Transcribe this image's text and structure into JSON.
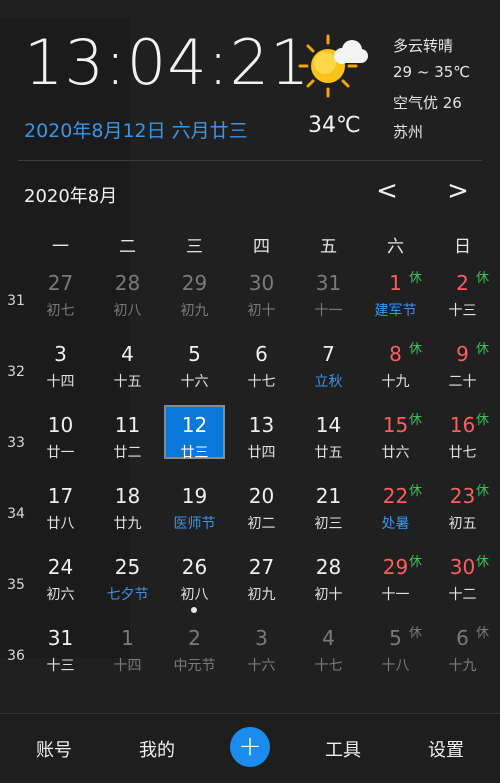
{
  "clock": {
    "time": "13:04:21"
  },
  "date": {
    "line": "2020年8月12日 六月廿三"
  },
  "weather": {
    "icon": "sun-cloud-icon",
    "current_temp": "34℃",
    "condition": "多云转晴",
    "temp_range": "29 ~ 35℃",
    "air_quality": "空气优 26",
    "city": "苏州"
  },
  "calendar": {
    "month_title": "2020年8月",
    "prev_label": "<",
    "next_label": ">",
    "weekdays": [
      "一",
      "二",
      "三",
      "四",
      "五",
      "六",
      "日"
    ],
    "weeks": [
      {
        "num": "31",
        "days": [
          {
            "d": "27",
            "l": "初七",
            "other": true
          },
          {
            "d": "28",
            "l": "初八",
            "other": true
          },
          {
            "d": "29",
            "l": "初九",
            "other": true
          },
          {
            "d": "30",
            "l": "初十",
            "other": true
          },
          {
            "d": "31",
            "l": "十一",
            "other": true
          },
          {
            "d": "1",
            "l": "建军节",
            "fest": true,
            "weekend": true,
            "hol": "休"
          },
          {
            "d": "2",
            "l": "十三",
            "weekend": true,
            "hol": "休"
          }
        ]
      },
      {
        "num": "32",
        "days": [
          {
            "d": "3",
            "l": "十四"
          },
          {
            "d": "4",
            "l": "十五"
          },
          {
            "d": "5",
            "l": "十六"
          },
          {
            "d": "6",
            "l": "十七"
          },
          {
            "d": "7",
            "l": "立秋",
            "fest": true
          },
          {
            "d": "8",
            "l": "十九",
            "weekend": true,
            "hol": "休"
          },
          {
            "d": "9",
            "l": "二十",
            "weekend": true,
            "hol": "休"
          }
        ]
      },
      {
        "num": "33",
        "days": [
          {
            "d": "10",
            "l": "廿一"
          },
          {
            "d": "11",
            "l": "廿二"
          },
          {
            "d": "12",
            "l": "廿三",
            "selected": true
          },
          {
            "d": "13",
            "l": "廿四"
          },
          {
            "d": "14",
            "l": "廿五"
          },
          {
            "d": "15",
            "l": "廿六",
            "weekend": true,
            "hol": "休"
          },
          {
            "d": "16",
            "l": "廿七",
            "weekend": true,
            "hol": "休"
          }
        ]
      },
      {
        "num": "34",
        "days": [
          {
            "d": "17",
            "l": "廿八"
          },
          {
            "d": "18",
            "l": "廿九"
          },
          {
            "d": "19",
            "l": "医师节",
            "fest": true
          },
          {
            "d": "20",
            "l": "初二"
          },
          {
            "d": "21",
            "l": "初三"
          },
          {
            "d": "22",
            "l": "处暑",
            "fest": true,
            "weekend": true,
            "hol": "休"
          },
          {
            "d": "23",
            "l": "初五",
            "weekend": true,
            "hol": "休"
          }
        ]
      },
      {
        "num": "35",
        "days": [
          {
            "d": "24",
            "l": "初六"
          },
          {
            "d": "25",
            "l": "七夕节",
            "fest": true
          },
          {
            "d": "26",
            "l": "初八",
            "dot": true
          },
          {
            "d": "27",
            "l": "初九"
          },
          {
            "d": "28",
            "l": "初十"
          },
          {
            "d": "29",
            "l": "十一",
            "weekend": true,
            "hol": "休"
          },
          {
            "d": "30",
            "l": "十二",
            "weekend": true,
            "hol": "休"
          }
        ]
      },
      {
        "num": "36",
        "days": [
          {
            "d": "31",
            "l": "十三"
          },
          {
            "d": "1",
            "l": "十四",
            "other": true
          },
          {
            "d": "2",
            "l": "中元节",
            "other": true
          },
          {
            "d": "3",
            "l": "十六",
            "other": true
          },
          {
            "d": "4",
            "l": "十七",
            "other": true
          },
          {
            "d": "5",
            "l": "十八",
            "other": true,
            "hol": "休"
          },
          {
            "d": "6",
            "l": "十九",
            "other": true,
            "hol": "休"
          }
        ]
      }
    ]
  },
  "bottom_nav": {
    "account": "账号",
    "mine": "我的",
    "add": "+",
    "tools": "工具",
    "settings": "设置"
  },
  "colors": {
    "accent": "#0a78d7",
    "festival": "#3a95e8",
    "weekend": "#ff5d5d",
    "holiday": "#39c05a"
  }
}
